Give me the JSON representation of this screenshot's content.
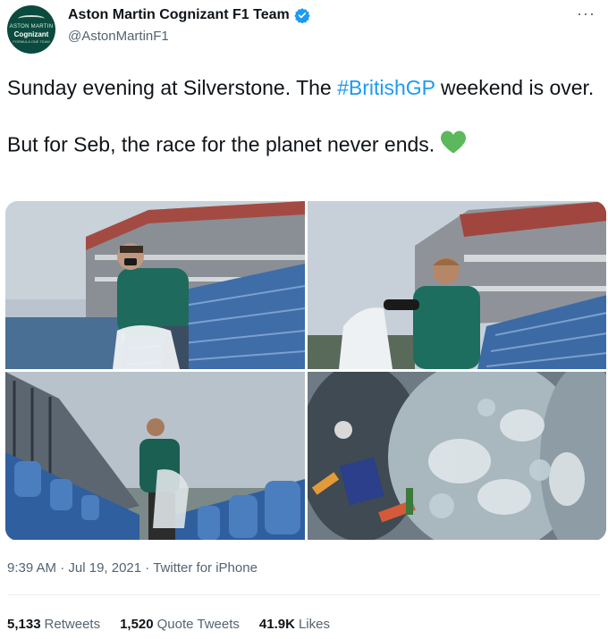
{
  "account": {
    "display_name": "Aston Martin Cognizant F1 Team",
    "handle": "@AstonMartinF1",
    "avatar_brand": "ASTON MARTIN",
    "avatar_sponsor": "Cognizant",
    "avatar_sub": "FORMULA ONE TEAM",
    "verified": true
  },
  "tweet": {
    "line1_prefix": "Sunday evening at Silverstone. The ",
    "hashtag": "#BritishGP",
    "line1_suffix": " weekend is over.",
    "line2": "But for Seb, the race for the planet never ends.",
    "emoji": "green-heart"
  },
  "photos": [
    {
      "name": "photo-seb-collecting-litter-stands"
    },
    {
      "name": "photo-seb-back-view-grandstand"
    },
    {
      "name": "photo-seb-between-seat-rows"
    },
    {
      "name": "photo-bags-of-plastic-waste"
    }
  ],
  "meta": {
    "time": "9:39 AM",
    "separator": " · ",
    "date": "Jul 19, 2021",
    "source": "Twitter for iPhone"
  },
  "stats": {
    "retweets_count": "5,133",
    "retweets_label": "Retweets",
    "quotes_count": "1,520",
    "quotes_label": "Quote Tweets",
    "likes_count": "41.9K",
    "likes_label": "Likes"
  },
  "colors": {
    "link": "#1d9bf0",
    "verified": "#1d9bf0",
    "heart": "#5cb85c",
    "secondary_text": "#536471",
    "brand_green": "#0b4a3e"
  }
}
